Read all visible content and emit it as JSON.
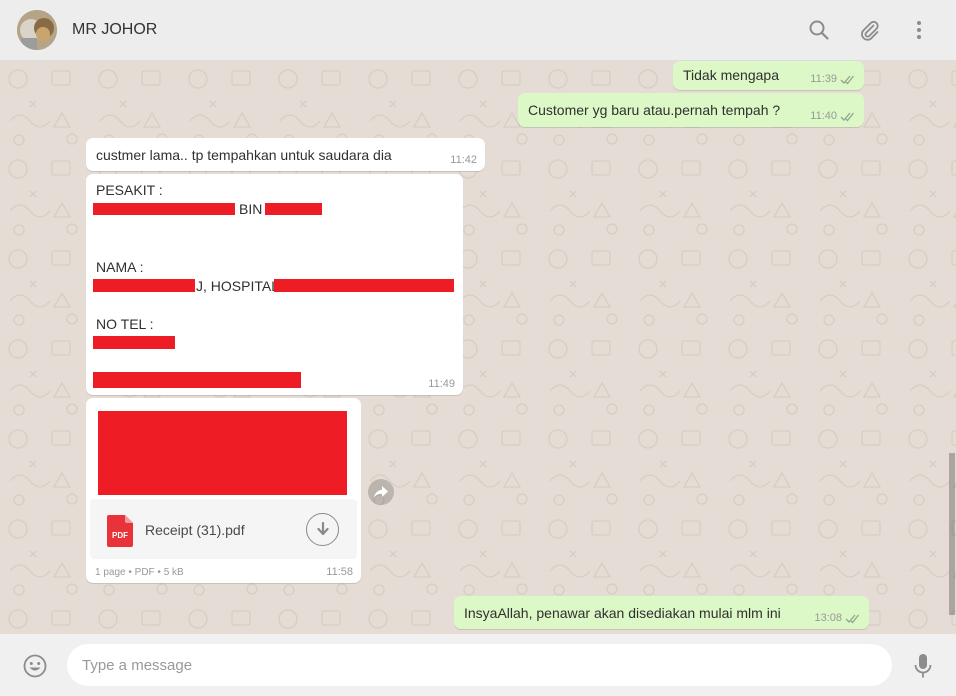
{
  "header": {
    "contact_name": "MR JOHOR",
    "icons": [
      "search-icon",
      "attach-icon",
      "menu-icon"
    ]
  },
  "messages": [
    {
      "id": "m1",
      "direction": "outgoing",
      "text": "Tidak mengapa",
      "time": "11:39",
      "status": "read"
    },
    {
      "id": "m2",
      "direction": "outgoing",
      "text": "Customer yg baru atau.pernah tempah ?",
      "time": "11:40",
      "status": "read"
    },
    {
      "id": "m3",
      "direction": "incoming",
      "text": "custmer   lama.. tp tempahkan untuk saudara dia",
      "time": "11:42"
    },
    {
      "id": "m4",
      "direction": "incoming",
      "time": "11:49",
      "lines": {
        "pesakit": "PESAKIT :",
        "bin": "BIN",
        "nama": "NAMA :",
        "hospital": "J, HOSPITAL",
        "notel": "NO TEL :"
      }
    },
    {
      "id": "m5",
      "direction": "incoming",
      "type": "document",
      "time": "11:58",
      "file_name": "Receipt (31).pdf",
      "file_badge": "PDF",
      "meta": "1 page • PDF • 5 kB"
    },
    {
      "id": "m6",
      "direction": "outgoing",
      "text": "InsyaAllah, penawar akan disediakan mulai mlm ini",
      "time": "13:08",
      "status": "read"
    }
  ],
  "composer": {
    "placeholder": "Type a message",
    "value": ""
  },
  "colors": {
    "outgoing_bubble": "#dcf8c6",
    "incoming_bubble": "#ffffff",
    "chat_background": "#e5ddd5",
    "redaction": "#ee1c25",
    "read_ticks": "#92a58c"
  }
}
